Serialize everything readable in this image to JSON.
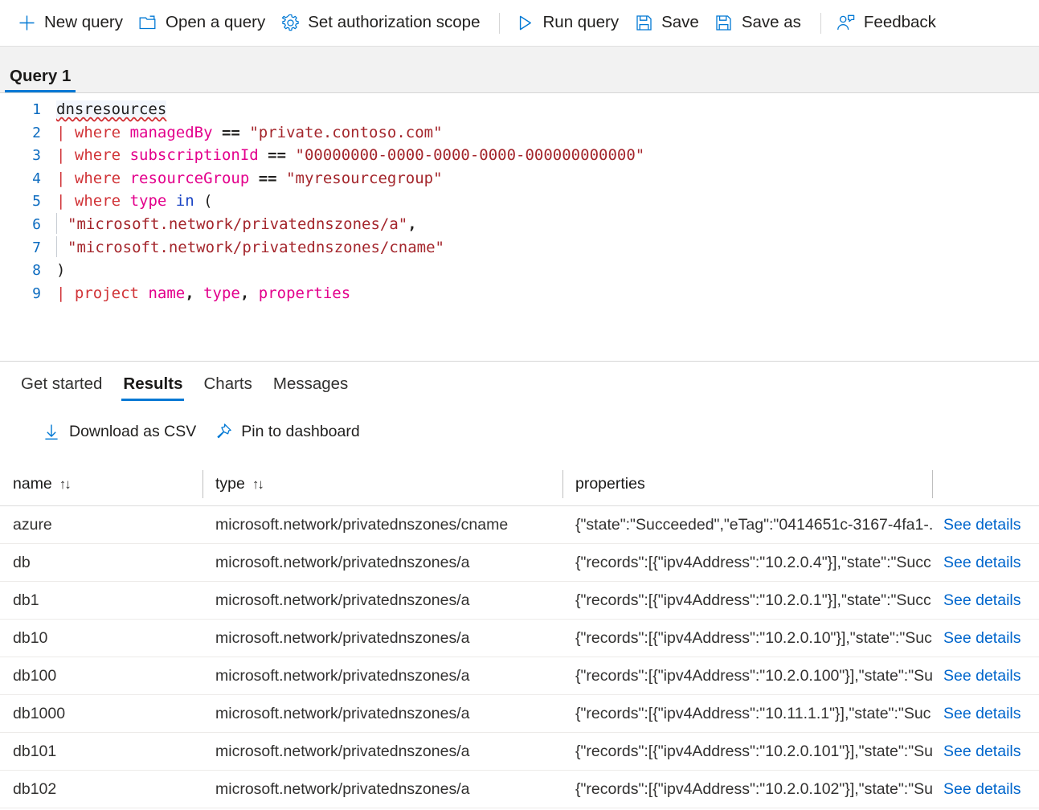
{
  "commandbar": {
    "items": [
      {
        "label": "New query",
        "icon": "plus-icon"
      },
      {
        "label": "Open a query",
        "icon": "folder-open-icon"
      },
      {
        "label": "Set authorization scope",
        "icon": "gear-icon"
      },
      {
        "label": "Run query",
        "icon": "play-icon"
      },
      {
        "label": "Save",
        "icon": "save-icon"
      },
      {
        "label": "Save as",
        "icon": "save-as-icon"
      },
      {
        "label": "Feedback",
        "icon": "person-feedback-icon"
      }
    ]
  },
  "query_tab": {
    "label": "Query 1"
  },
  "editor": {
    "lines": [
      {
        "num": "1",
        "text": "dnsresources"
      },
      {
        "num": "2",
        "text": "| where managedBy == \"private.contoso.com\""
      },
      {
        "num": "3",
        "text": "| where subscriptionId == \"00000000-0000-0000-0000-000000000000\""
      },
      {
        "num": "4",
        "text": "| where resourceGroup == \"myresourcegroup\""
      },
      {
        "num": "5",
        "text": "| where type in ("
      },
      {
        "num": "6",
        "text": "    \"microsoft.network/privatednszones/a\","
      },
      {
        "num": "7",
        "text": "    \"microsoft.network/privatednszones/cname\""
      },
      {
        "num": "8",
        "text": ")"
      },
      {
        "num": "9",
        "text": "| project name, type, properties"
      }
    ],
    "tokens": {
      "table": "dnsresources",
      "kw_where": "where",
      "kw_project": "project",
      "op_in": "in",
      "op_eq": "==",
      "pipe": "|",
      "id_managedBy": "managedBy",
      "id_subscriptionId": "subscriptionId",
      "id_resourceGroup": "resourceGroup",
      "id_type": "type",
      "id_name": "name",
      "id_properties": "properties",
      "str_domain": "\"private.contoso.com\"",
      "str_subid": "\"00000000-0000-0000-0000-000000000000\"",
      "str_rg": "\"myresourcegroup\"",
      "str_type_a": "\"microsoft.network/privatednszones/a\"",
      "str_type_cname": "\"microsoft.network/privatednszones/cname\"",
      "paren_open": "(",
      "paren_close": ")",
      "comma": ",",
      "comma_sp1": ", ",
      "comma_sp2": ", "
    }
  },
  "results": {
    "tabs": [
      {
        "label": "Get started",
        "active": false
      },
      {
        "label": "Results",
        "active": true
      },
      {
        "label": "Charts",
        "active": false
      },
      {
        "label": "Messages",
        "active": false
      }
    ],
    "actions": [
      {
        "label": "Download as CSV",
        "icon": "download-icon"
      },
      {
        "label": "Pin to dashboard",
        "icon": "pin-icon"
      }
    ],
    "columns": [
      {
        "key": "name",
        "label": "name",
        "sortable": true,
        "sort_icon": "sort-updown-icon"
      },
      {
        "key": "type",
        "label": "type",
        "sortable": true,
        "sort_icon": "sort-updown-icon"
      },
      {
        "key": "properties",
        "label": "properties",
        "sortable": false,
        "sort_icon": ""
      }
    ],
    "action_link_label": "See details",
    "rows": [
      {
        "name": "azure",
        "type": "microsoft.network/privatednszones/cname",
        "properties": "{\"state\":\"Succeeded\",\"eTag\":\"0414651c-3167-4fa1-..."
      },
      {
        "name": "db",
        "type": "microsoft.network/privatednszones/a",
        "properties": "{\"records\":[{\"ipv4Address\":\"10.2.0.4\"}],\"state\":\"Succ..."
      },
      {
        "name": "db1",
        "type": "microsoft.network/privatednszones/a",
        "properties": "{\"records\":[{\"ipv4Address\":\"10.2.0.1\"}],\"state\":\"Succ..."
      },
      {
        "name": "db10",
        "type": "microsoft.network/privatednszones/a",
        "properties": "{\"records\":[{\"ipv4Address\":\"10.2.0.10\"}],\"state\":\"Suc..."
      },
      {
        "name": "db100",
        "type": "microsoft.network/privatednszones/a",
        "properties": "{\"records\":[{\"ipv4Address\":\"10.2.0.100\"}],\"state\":\"Su..."
      },
      {
        "name": "db1000",
        "type": "microsoft.network/privatednszones/a",
        "properties": "{\"records\":[{\"ipv4Address\":\"10.11.1.1\"}],\"state\":\"Suc..."
      },
      {
        "name": "db101",
        "type": "microsoft.network/privatednszones/a",
        "properties": "{\"records\":[{\"ipv4Address\":\"10.2.0.101\"}],\"state\":\"Su..."
      },
      {
        "name": "db102",
        "type": "microsoft.network/privatednszones/a",
        "properties": "{\"records\":[{\"ipv4Address\":\"10.2.0.102\"}],\"state\":\"Su..."
      }
    ]
  },
  "colors": {
    "accent": "#0078d4",
    "link": "#0066cc",
    "keyword": "#d13438",
    "identifier": "#e3008c",
    "string": "#a4262c",
    "operator_in": "#1b45c4",
    "line_number": "#0d6cc0",
    "tab_strip_bg": "#f2f2f2",
    "code_highlight": "#f2f6fc"
  }
}
